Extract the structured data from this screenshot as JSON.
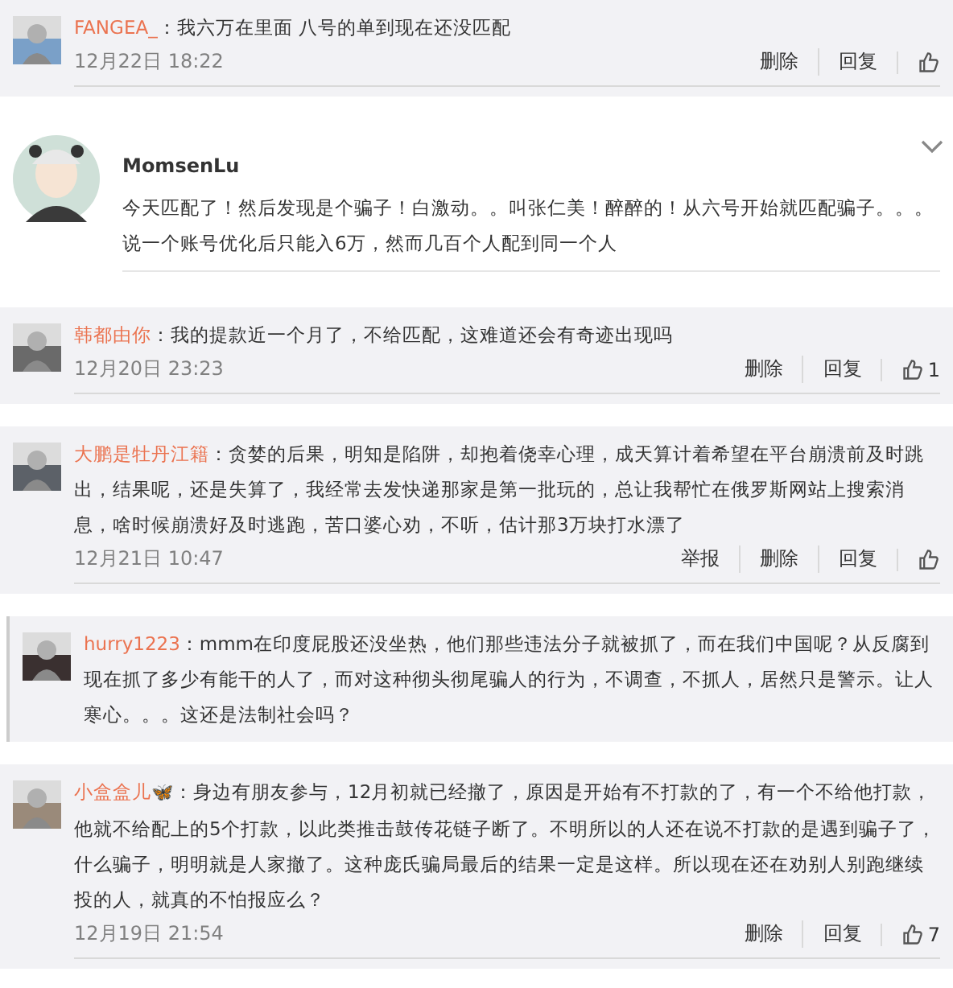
{
  "items": [
    {
      "kind": "comment",
      "author": "FANGEA_",
      "text": "：我六万在里面 八号的单到现在还没匹配",
      "date": "12月22日 18:22",
      "actions": [
        "删除",
        "回复"
      ],
      "bordered": false
    },
    {
      "kind": "post",
      "author": "MomsenLu",
      "lines": [
        "今天匹配了！然后发现是个骗子！白激动。。叫张仁美！醉醉的！从六号开始就匹配骗子。。。",
        "说一个账号优化后只能入6万，然而几百个人配到同一个人"
      ]
    },
    {
      "kind": "comment",
      "author": "韩都由你",
      "text": "：我的提款近一个月了，不给匹配，这难道还会有奇迹出现吗",
      "date": "12月20日 23:23",
      "actions": [
        "删除",
        "回复"
      ],
      "likes": "1",
      "bordered": false
    },
    {
      "kind": "comment",
      "author": "大鹏是牡丹江籍",
      "text": "：贪婪的后果，明知是陷阱，却抱着侥幸心理，成天算计着希望在平台崩溃前及时跳出，结果呢，还是失算了，我经常去发快递那家是第一批玩的，总让我帮忙在俄罗斯网站上搜索消息，啥时候崩溃好及时逃跑，苦口婆心劝，不听，估计那3万块打水漂了",
      "date": "12月21日 10:47",
      "actions": [
        "举报",
        "删除",
        "回复"
      ],
      "bordered": false
    },
    {
      "kind": "comment",
      "author": "hurry1223",
      "text": "：mmm在印度屁股还没坐热，他们那些违法分子就被抓了，而在我们中国呢？从反腐到现在抓了多少有能干的人了，而对这种彻头彻尾骗人的行为，不调查，不抓人，居然只是警示。让人寒心。。。这还是法制社会吗？",
      "bordered": true
    },
    {
      "kind": "comment",
      "author": "小盒盒儿",
      "badge": "🦋",
      "text": "：身边有朋友参与，12月初就已经撤了，原因是开始有不打款的了，有一个不给他打款，他就不给配上的5个打款，以此类推击鼓传花链子断了。不明所以的人还在说不打款的是遇到骗子了，什么骗子，明明就是人家撤了。这种庞氏骗局最后的结果一定是这样。所以现在还在劝别人别跑继续投的人，就真的不怕报应么？",
      "date": "12月19日 21:54",
      "actions": [
        "删除",
        "回复"
      ],
      "likes": "7",
      "bordered": false
    }
  ]
}
